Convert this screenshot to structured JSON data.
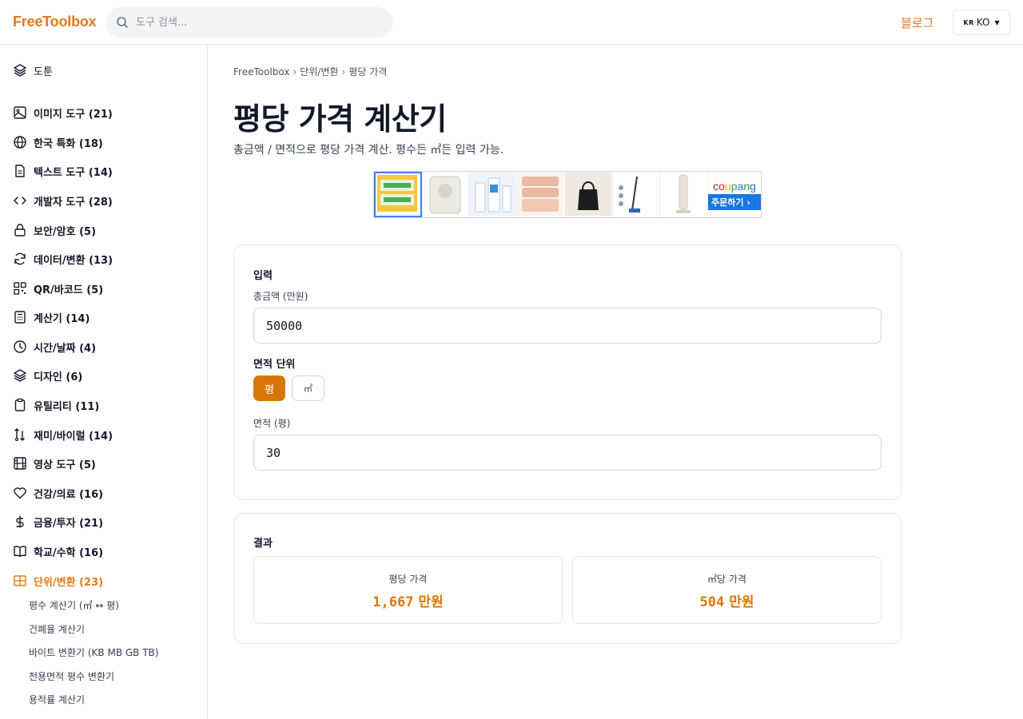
{
  "header": {
    "logo": "FreeToolbox",
    "search_placeholder": "도구 검색...",
    "blog_label": "블로그",
    "lang_flag": "KR",
    "lang_label": "KO"
  },
  "colors": {
    "accent": "#e07b1c",
    "accent_button": "#d97706",
    "border": "#e5e7eb"
  },
  "sidebar": {
    "top_item": {
      "label": "도툰",
      "icon": "layers-icon"
    },
    "categories": [
      {
        "label": "이미지 도구 (21)",
        "icon": "image-icon"
      },
      {
        "label": "한국 특화 (18)",
        "icon": "globe-icon"
      },
      {
        "label": "텍스트 도구 (14)",
        "icon": "file-text-icon"
      },
      {
        "label": "개발자 도구 (28)",
        "icon": "code-icon"
      },
      {
        "label": "보안/암호 (5)",
        "icon": "lock-icon"
      },
      {
        "label": "데이터/변환 (13)",
        "icon": "refresh-icon"
      },
      {
        "label": "QR/바코드 (5)",
        "icon": "qr-icon"
      },
      {
        "label": "계산기 (14)",
        "icon": "calculator-icon"
      },
      {
        "label": "시간/날짜 (4)",
        "icon": "clock-icon"
      },
      {
        "label": "디자인 (6)",
        "icon": "layers-icon"
      },
      {
        "label": "유틸리티 (11)",
        "icon": "clipboard-icon"
      },
      {
        "label": "재미/바이럴 (14)",
        "icon": "shuffle-icon"
      },
      {
        "label": "영상 도구 (5)",
        "icon": "film-icon"
      },
      {
        "label": "건강/의료 (16)",
        "icon": "heart-icon"
      },
      {
        "label": "금융/투자 (21)",
        "icon": "dollar-icon"
      },
      {
        "label": "학교/수학 (16)",
        "icon": "book-icon"
      },
      {
        "label": "단위/변환 (23)",
        "icon": "grid-icon",
        "active": true
      }
    ],
    "sub_items": [
      "평수 계산기 (㎡ ↔ 평)",
      "건폐율 계산기",
      "바이트 변환기 (KB MB GB TB)",
      "전용면적 평수 변환기",
      "용적률 계산기"
    ]
  },
  "breadcrumb": {
    "root": "FreeToolbox",
    "category": "단위/변환",
    "current": "평당 가격",
    "sep": "›"
  },
  "page": {
    "title": "평당 가격 계산기",
    "description": "총금액 / 면적으로 평당 가격 계산. 평수든 ㎡든 입력 가능."
  },
  "ad": {
    "brand": "coupang",
    "cta": "주문하기 ›",
    "brand_colors": [
      "#e52528",
      "#f5a623",
      "#2f9f48",
      "#1677e5"
    ]
  },
  "input_card": {
    "title": "입력",
    "total_label": "총금액 (만원)",
    "total_value": "50000",
    "unit_label": "면적 단위",
    "unit_options": [
      "평",
      "㎡"
    ],
    "unit_selected": "평",
    "area_label": "면적 (평)",
    "area_value": "30"
  },
  "result_card": {
    "title": "결과",
    "per_pyeong": {
      "label": "평당 가격",
      "value": "1,667",
      "unit": "만원"
    },
    "per_sqm": {
      "label": "㎡당 가격",
      "value": "504",
      "unit": "만원"
    }
  }
}
